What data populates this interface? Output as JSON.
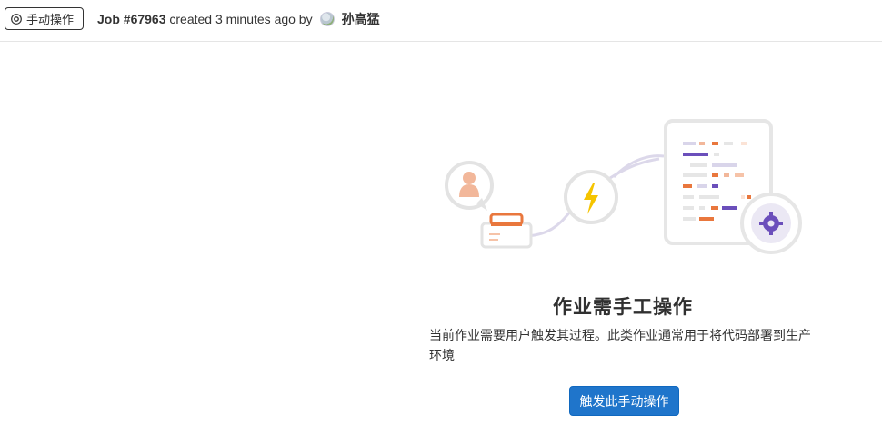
{
  "header": {
    "status_badge": {
      "label": "手动操作",
      "icon": "gear-icon"
    },
    "job_id": "Job #67963",
    "created_text": "created 3 minutes ago by",
    "author_name": "孙高猛",
    "author_avatar": "avatar"
  },
  "empty_state": {
    "title": "作业需手工操作",
    "description": "当前作业需要用户触发其过程。此类作业通常用于将代码部署到生产环境",
    "button_label": "触发此手动操作"
  },
  "colors": {
    "primary": "#1f75cb",
    "accent_orange": "#e9773d",
    "accent_purple": "#6b4fbb",
    "accent_yellow": "#f5c400"
  }
}
